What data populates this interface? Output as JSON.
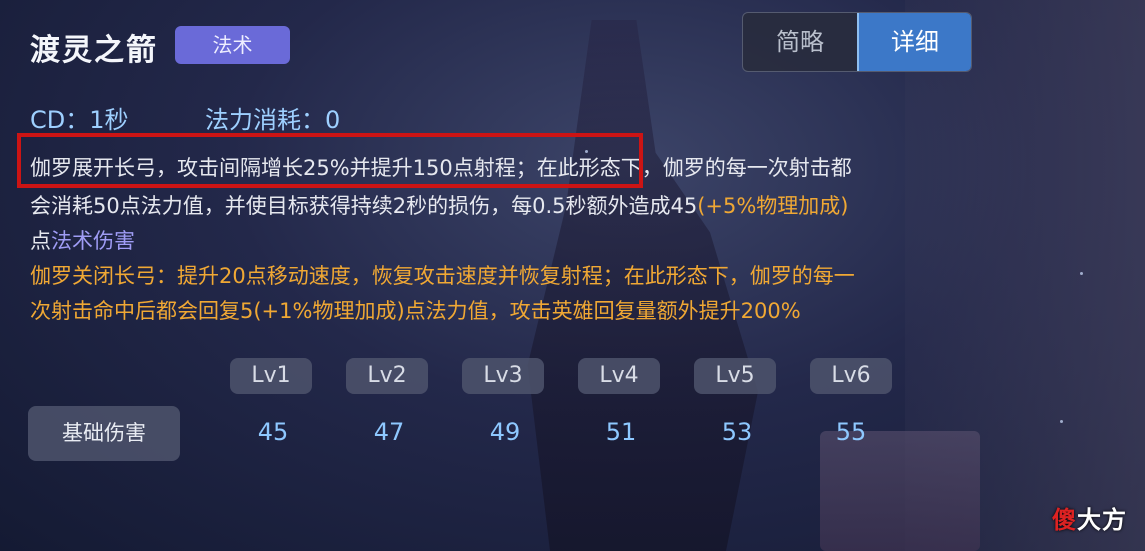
{
  "skill": {
    "name": "渡灵之箭",
    "type_badge": "法术"
  },
  "view_toggle": {
    "brief": "简略",
    "detail": "详细",
    "active": "详细"
  },
  "stats": {
    "cd": "CD：1秒",
    "mana_cost": "法力消耗：0"
  },
  "description": {
    "line1_part1": "伽罗展开长弓，攻击间隔增长25%并提升150点射程；",
    "line1_part2": "在此形态下，伽罗的每一次射击都",
    "line2_white": "会消耗50点法力值，并使目标获得持续2秒的损伤，每0.5秒额外造成45",
    "line2_orange": "(+5%物理加成)",
    "line3_white": "点",
    "line3_purple": "法术伤害",
    "line4": "伽罗关闭长弓：提升20点移动速度，恢复攻击速度并恢复射程；在此形态下，伽罗的每一",
    "line5": "次射击命中后都会回复5(+1%物理加成)点法力值，攻击英雄回复量额外提升200%"
  },
  "levels": {
    "headers": [
      "Lv1",
      "Lv2",
      "Lv3",
      "Lv4",
      "Lv5",
      "Lv6"
    ],
    "row_label": "基础伤害",
    "values": [
      "45",
      "47",
      "49",
      "51",
      "53",
      "55"
    ]
  },
  "watermark": {
    "first_char": "傻",
    "rest": "大方"
  },
  "colors": {
    "accent_blue": "#3c78c8",
    "badge_purple": "#6a6ad8",
    "orange_text": "#f0a834",
    "highlight_red": "#cc1414"
  }
}
